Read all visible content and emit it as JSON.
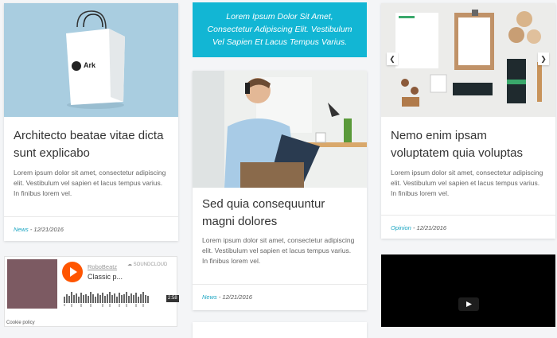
{
  "colors": {
    "accent": "#12b6d4",
    "category": "#1aa5c2",
    "soundcloud_orange": "#ff5500"
  },
  "cards": [
    {
      "title": "Architecto beatae vitae dicta sunt explicabo",
      "excerpt": "Lorem ipsum dolor sit amet, consectetur adipiscing elit. Vestibulum vel sapien et lacus tempus varius. In finibus lorem vel.",
      "category": "News",
      "date": " - 12/21/2016",
      "image_alt": "Ark shopping bag",
      "logo_text": "Ark"
    },
    {
      "title": "Sed quia consequuntur magni dolores",
      "excerpt": "Lorem ipsum dolor sit amet, consectetur adipiscing elit. Vestibulum vel sapien et lacus tempus varius. In finibus lorem vel.",
      "category": "News",
      "date": " - 12/21/2016",
      "image_alt": "man on phone holding clipboard"
    },
    {
      "title": "Nemo enim ipsam voluptatem quia voluptas",
      "excerpt": "Lorem ipsum dolor sit amet, consectetur adipiscing elit. Vestibulum vel sapien et lacus tempus varius. In finibus lorem vel.",
      "category": "Opinion",
      "date": " - 12/21/2016",
      "image_alt": "branding mockup",
      "prev_icon": "chevron-left-icon",
      "next_icon": "chevron-right-icon"
    }
  ],
  "quote": "Lorem Ipsum Dolor Sit Amet, Consectetur Adipiscing Elit. Vestibulum Vel Sapien Et Lacus Tempus Varius.",
  "soundcloud": {
    "artist": "RoboBeatz",
    "track": "Classic p...",
    "brand": "SOUNDCLOUD",
    "duration": "2:58",
    "cookie": "Cookie policy"
  },
  "video": {
    "icon": "play-icon"
  }
}
